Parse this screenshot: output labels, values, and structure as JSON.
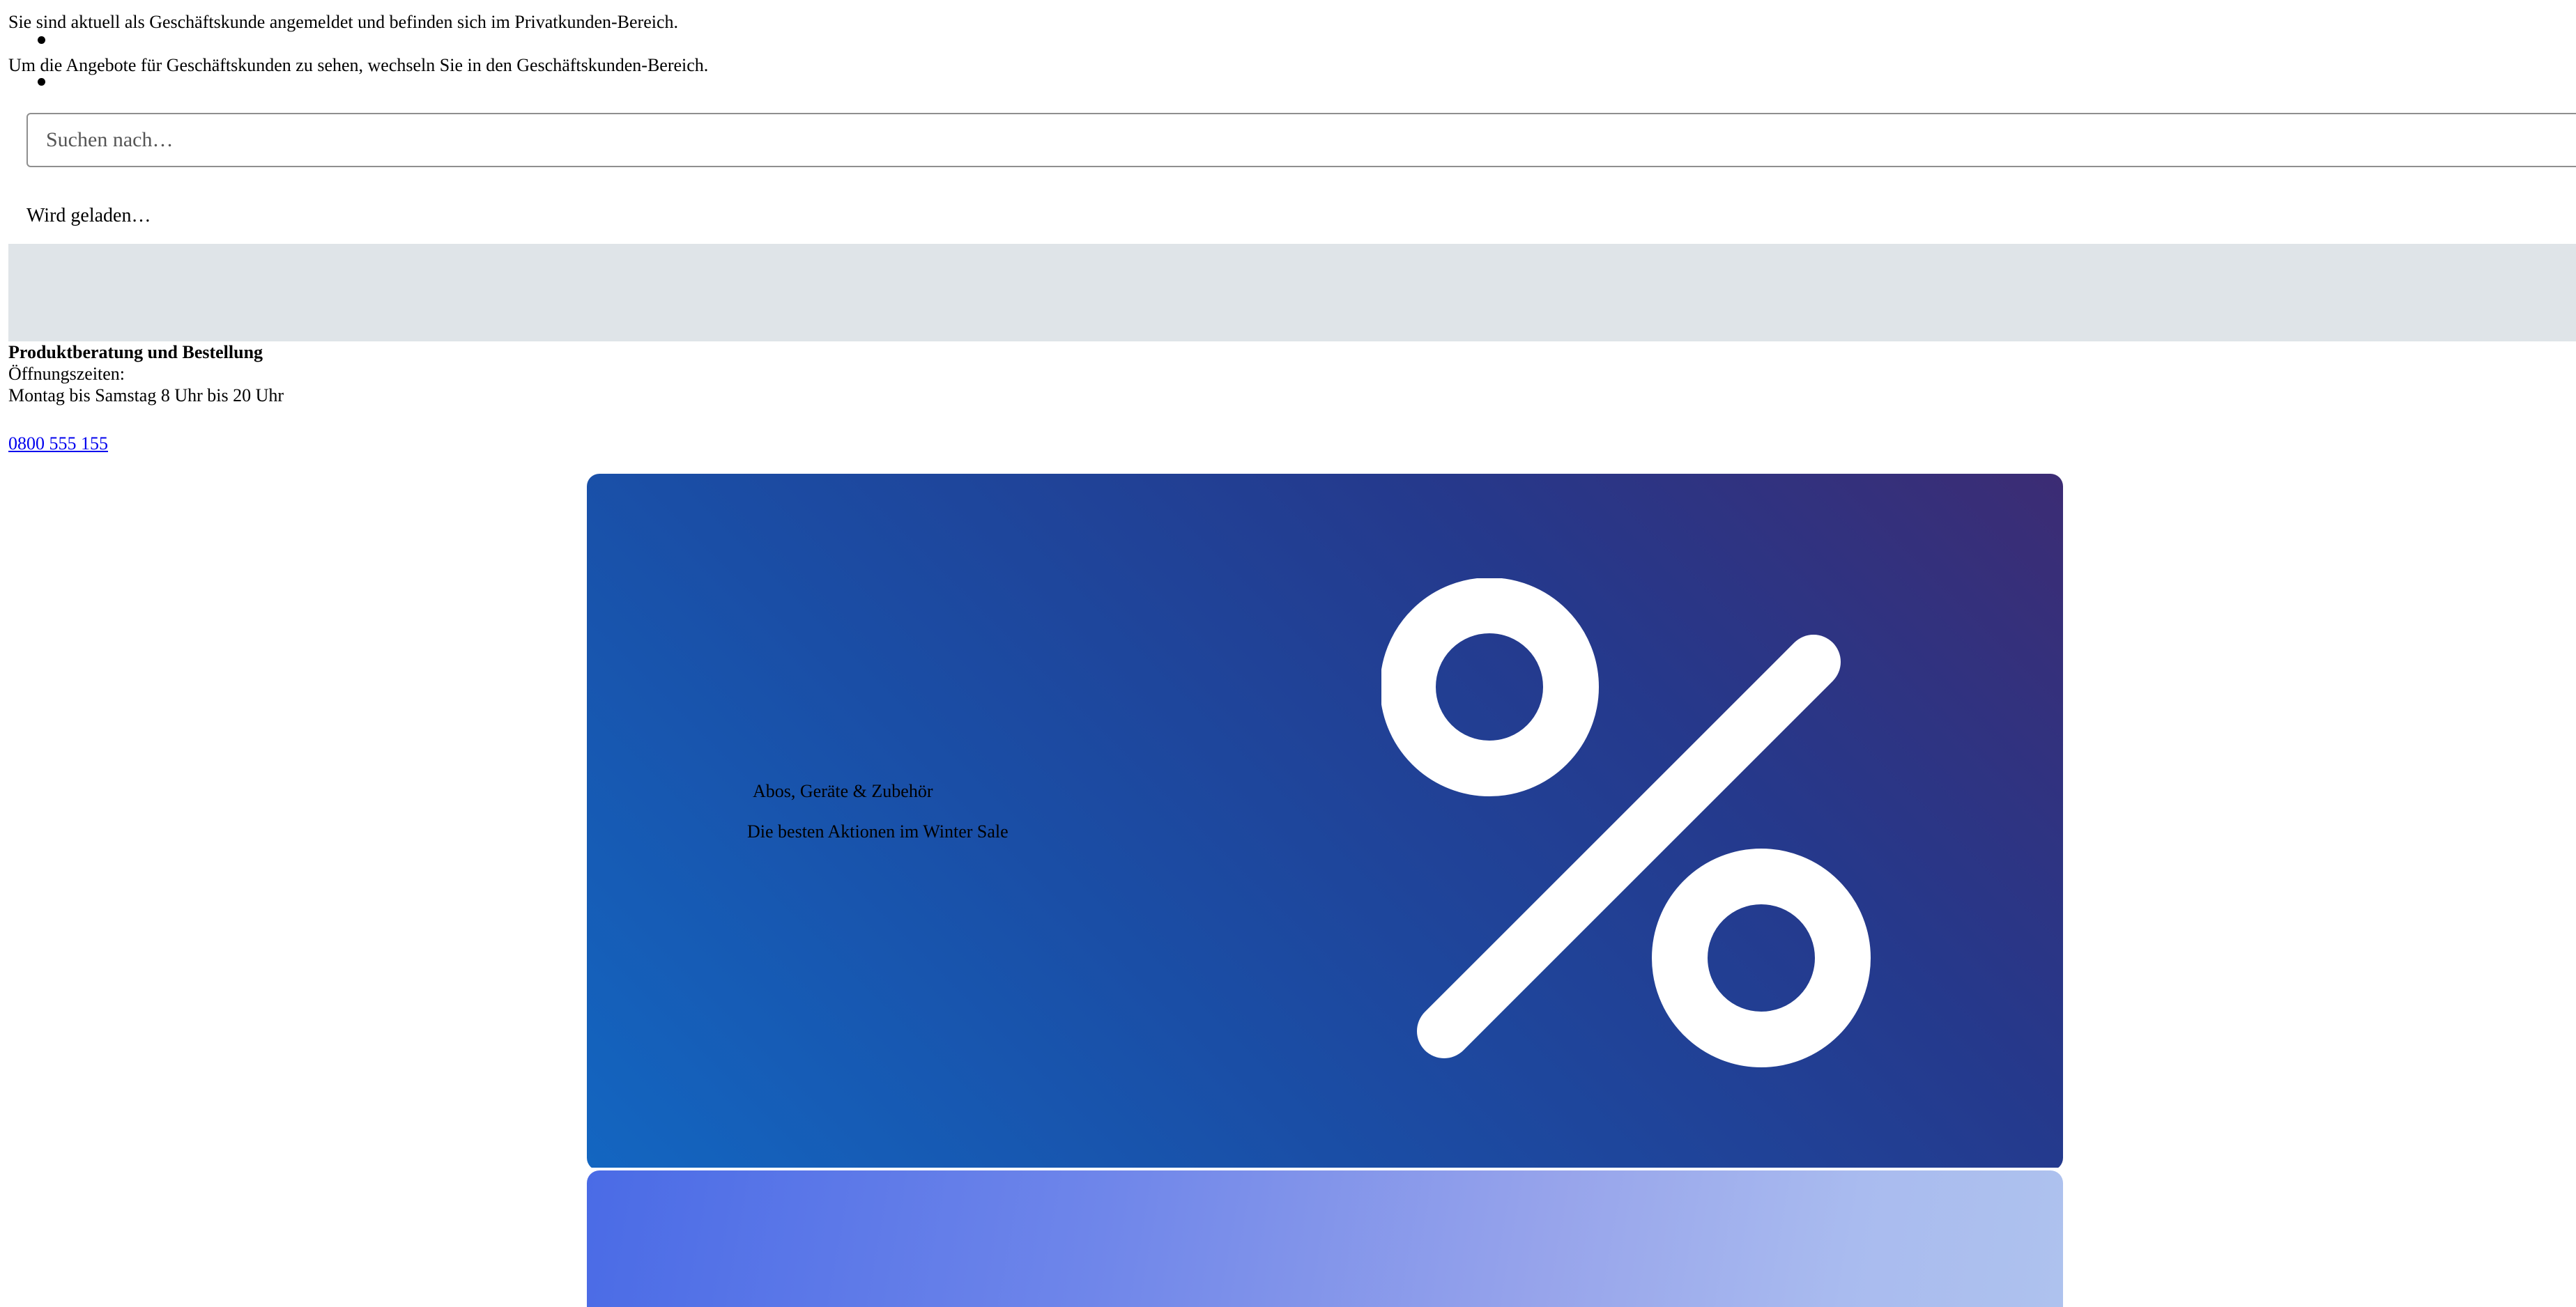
{
  "notice": {
    "line1": "Sie sind aktuell als Geschäftskunde angemeldet und befinden sich im Privatkunden-Bereich.",
    "line2": "Um die Angebote für Geschäftskunden zu sehen, wechseln Sie in den Geschäftskunden-Bereich."
  },
  "search": {
    "placeholder": "Suchen nach…",
    "value": ""
  },
  "status": {
    "loading": "Wird geladen…"
  },
  "contact": {
    "heading": "Produktberatung und Bestellung",
    "hours_label": "Öffnungszeiten:",
    "hours": "Montag bis Samstag 8 Uhr bis 20 Uhr",
    "phone": "0800 555 155"
  },
  "hero": {
    "eyebrow": "Abos, Geräte & Zubehör",
    "title": "Die besten Aktionen im Winter Sale",
    "icon": "percent-icon"
  },
  "colors": {
    "hero_gradient_start": "#1366c1",
    "hero_gradient_end": "#3c2c74",
    "band_gray": "#dfe4e8",
    "link": "#0000ee"
  }
}
